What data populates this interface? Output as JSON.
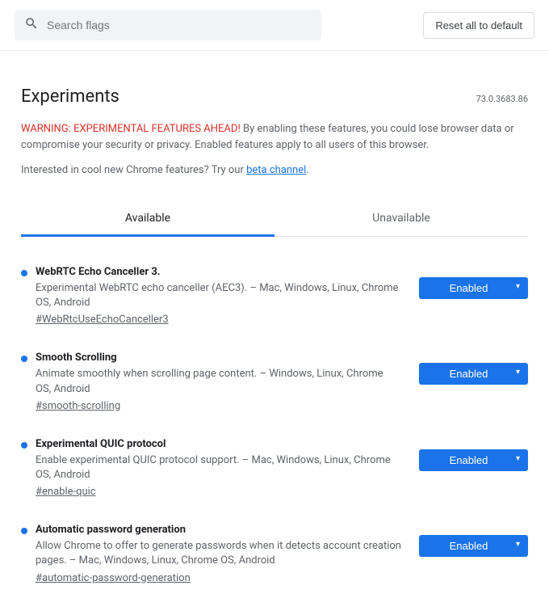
{
  "search": {
    "placeholder": "Search flags"
  },
  "reset_label": "Reset all to default",
  "title": "Experiments",
  "version": "73.0.3683.86",
  "warning_head": "WARNING: EXPERIMENTAL FEATURES AHEAD!",
  "warning_body": " By enabling these features, you could lose browser data or compromise your security or privacy. Enabled features apply to all users of this browser.",
  "interest_pre": "Interested in cool new Chrome features? Try our ",
  "interest_link": "beta channel",
  "interest_post": ".",
  "tabs": {
    "available": "Available",
    "unavailable": "Unavailable"
  },
  "flags": [
    {
      "title": "WebRTC Echo Canceller 3.",
      "desc": "Experimental WebRTC echo canceller (AEC3). – Mac, Windows, Linux, Chrome OS, Android",
      "hash": "#WebRtcUseEchoCanceller3",
      "state": "Enabled"
    },
    {
      "title": "Smooth Scrolling",
      "desc": "Animate smoothly when scrolling page content. – Windows, Linux, Chrome OS, Android",
      "hash": "#smooth-scrolling",
      "state": "Enabled"
    },
    {
      "title": "Experimental QUIC protocol",
      "desc": "Enable experimental QUIC protocol support. – Mac, Windows, Linux, Chrome OS, Android",
      "hash": "#enable-quic",
      "state": "Enabled"
    },
    {
      "title": "Automatic password generation",
      "desc": "Allow Chrome to offer to generate passwords when it detects account creation pages. – Mac, Windows, Linux, Chrome OS, Android",
      "hash": "#automatic-password-generation",
      "state": "Enabled"
    }
  ]
}
